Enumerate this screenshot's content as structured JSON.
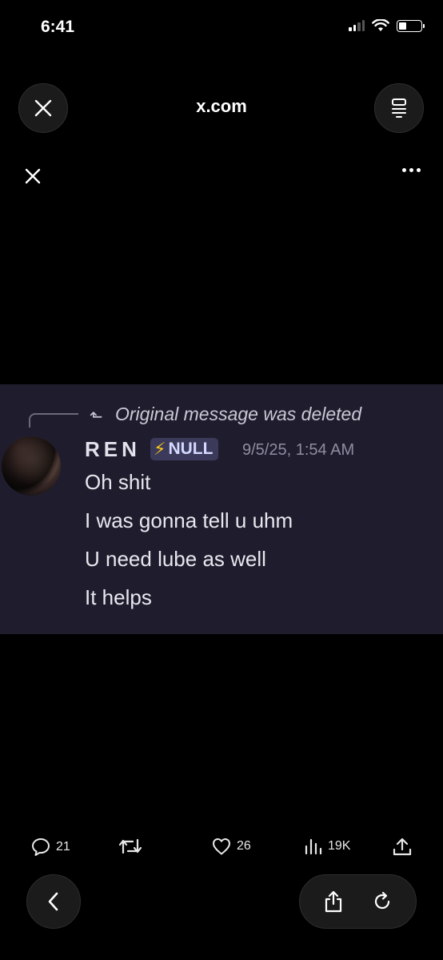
{
  "status_bar": {
    "time": "6:41"
  },
  "browser": {
    "url": "x.com"
  },
  "message": {
    "reply_notice": "Original message was deleted",
    "author": "REN",
    "badge": "NULL",
    "timestamp": "9/5/25, 1:54 AM",
    "lines": [
      "Oh shit",
      "I was gonna tell u uhm",
      "U need lube as well",
      "It helps"
    ]
  },
  "actions": {
    "replies": "21",
    "likes": "26",
    "views": "19K"
  },
  "colors": {
    "card_bg": "#1f1d2d",
    "badge_bg": "#3b3a5a",
    "bolt": "#f5c518"
  }
}
